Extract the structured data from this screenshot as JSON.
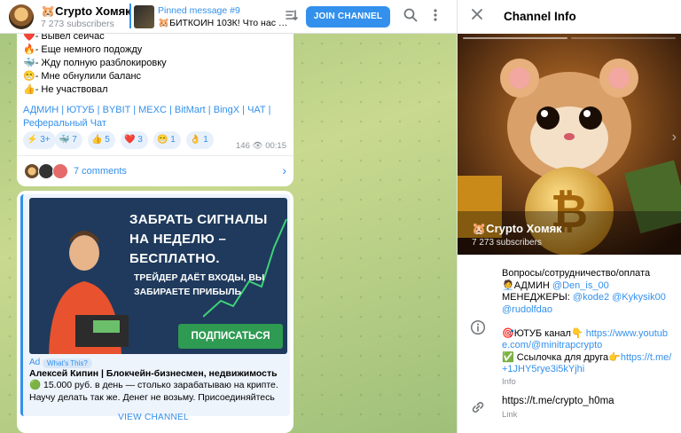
{
  "header": {
    "title": "🐹Crypto Хомяк",
    "subscribers": "7 273 subscribers",
    "pinned_title": "Pinned message #9",
    "pinned_text": "🐹БИТКОИН 103К! Что нас …",
    "join_label": "JOIN CHANNEL"
  },
  "message1": {
    "lines": [
      "❤️- Вывел сейчас",
      "🔥- Еще немного подожду",
      "🐳- Жду полную разблокировку",
      "😁- Мне обнулили баланс",
      "👍- Не участвовал"
    ],
    "links": [
      "АДМИН",
      "ЮТУБ",
      "BYBIT",
      "MEXC",
      "BitMart",
      "BingX",
      "ЧАТ",
      "Реферальный Чат"
    ],
    "link_separator": " | ",
    "reactions": [
      {
        "emoji": "⚡",
        "count": "3+"
      },
      {
        "emoji": "🐳",
        "count": "7"
      },
      {
        "emoji": "👍",
        "count": "5"
      },
      {
        "emoji": "❤️",
        "count": "3"
      },
      {
        "emoji": "😁",
        "count": "1"
      },
      {
        "emoji": "👌",
        "count": "1"
      }
    ],
    "views": "146",
    "time": "00:15",
    "comments": "7 comments"
  },
  "ad": {
    "headline": "ЗАБРАТЬ СИГНАЛЫ НА НЕДЕЛЮ – БЕСПЛАТНО.",
    "subline": "ТРЕЙДЕР ДАЁТ ВХОДЫ, ВЫ ЗАБИРАЕТЕ ПРИБЫЛЬ",
    "cta": "ПОДПИСАТЬСЯ",
    "label": "Ad",
    "whats_this": "What's This?",
    "title": "Алексей Кипин | Блокчейн-бизнесмен, недвижимость",
    "text": "🟢 15.000 руб. в день — столько зарабатываю на крипте. Научу делать так же. Денег не возьму. Присоединяйтесь",
    "view_label": "VIEW CHANNEL"
  },
  "panel": {
    "title": "Channel Info",
    "hero_name": "🐹Crypto Хомяк",
    "hero_sub": "7 273 subscribers",
    "desc_pre": "Вопросы/сотрудничество/оплата",
    "desc_admin_label": "🧑‍💼АДМИН ",
    "desc_admin_link": "@Den_is_00",
    "desc_mgr_label": "МЕНЕДЖЕРЫ: ",
    "desc_mgr_link1": "@kode2",
    "desc_mgr_and": " @",
    "desc_mgr_link2": "Kykysik00",
    "desc_mgr_link3": "@rudolfdao",
    "desc_yt_label": "🎯ЮТУБ канал👇 ",
    "desc_yt_link": "https://www.youtube.com/@minitrapcrypto",
    "desc_ref_label": "✅ Ссылочка для друга👉",
    "desc_ref_link": "https://t.me/+1JHY5rye3i5kYjhi",
    "info_caption": "Info",
    "link": "https://t.me/crypto_h0ma",
    "link_caption": "Link",
    "colors": {
      "accent": "#3390ec",
      "muted": "#707579",
      "cta_green": "#2e9a52"
    }
  }
}
